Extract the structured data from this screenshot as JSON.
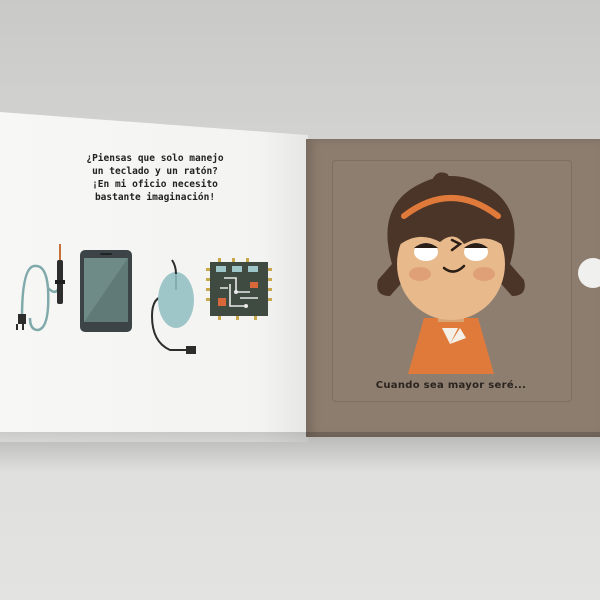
{
  "left_page": {
    "text_lines": [
      "¿Piensas que solo manejo",
      "un teclado y un ratón?",
      "¡En mi oficio necesito",
      "bastante imaginación!"
    ]
  },
  "right_page": {
    "caption": "Cuando sea mayor seré..."
  },
  "icons": [
    "soldering-iron-icon",
    "smartphone-icon",
    "computer-mouse-icon",
    "circuit-board-icon"
  ],
  "colors": {
    "right_page": "#8d7d6f",
    "hair": "#4a3528",
    "skin": "#e8b98a",
    "headband": "#e07a3a",
    "shirt": "#e07a3a",
    "mouse": "#9ec6c9"
  }
}
